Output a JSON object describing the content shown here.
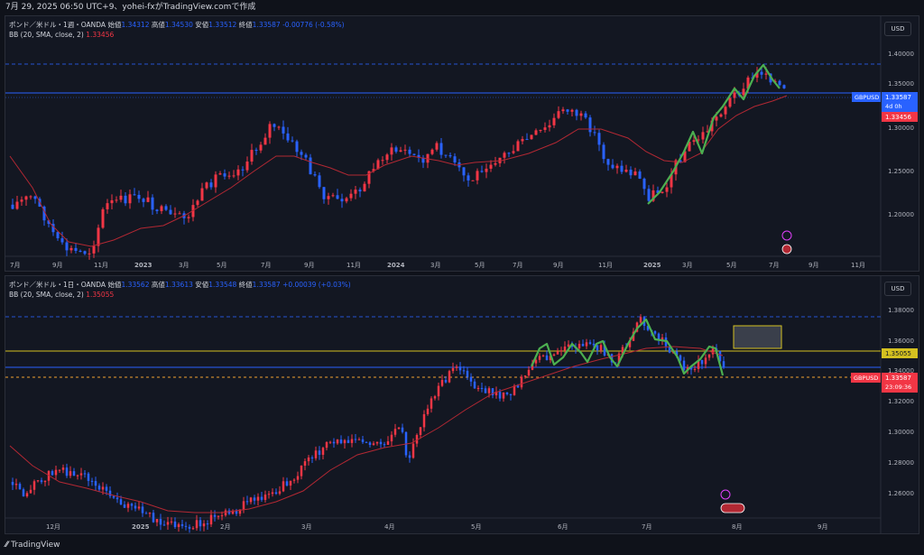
{
  "header": {
    "text": "7月 29, 2025 06:50 UTC+9、yohei-fxがTradingView.comで作成"
  },
  "top_chart": {
    "legend_title": "ポンド／米ドル・1週・OANDA",
    "open_label": "始値",
    "open": "1.34312",
    "high_label": "高値",
    "high": "1.34530",
    "low_label": "安値",
    "low": "1.33512",
    "close_label": "終値",
    "close": "1.33587",
    "change": "-0.00776 (-0.58%)",
    "bb_label": "BB (20, SMA, close, 2)",
    "bb_value": "1.33456",
    "currency": "USD",
    "price_ticks": [
      "1.40000",
      "1.35000",
      "1.30000",
      "1.25000",
      "1.20000"
    ],
    "time_ticks": [
      "7月",
      "9月",
      "11月",
      "2023",
      "3月",
      "5月",
      "7月",
      "9月",
      "11月",
      "2024",
      "3月",
      "5月",
      "7月",
      "9月",
      "11月",
      "2025",
      "3月",
      "5月",
      "7月",
      "9月",
      "11月"
    ],
    "symbol_tag": "GBPUSD",
    "price_tag": "1.33587",
    "countdown": "4d 0h",
    "bb_tag": "1.33456"
  },
  "bottom_chart": {
    "legend_title": "ポンド／米ドル・1日・OANDA",
    "open_label": "始値",
    "open": "1.33562",
    "high_label": "高値",
    "high": "1.33613",
    "low_label": "安値",
    "low": "1.33548",
    "close_label": "終値",
    "close": "1.33587",
    "change": "+0.00039 (+0.03%)",
    "bb_label": "BB (20, SMA, close, 2)",
    "bb_value": "1.35055",
    "currency": "USD",
    "price_ticks": [
      "1.38000",
      "1.36000",
      "1.34000",
      "1.32000",
      "1.30000",
      "1.28000",
      "1.26000"
    ],
    "time_ticks": [
      "12月",
      "2025",
      "2月",
      "3月",
      "4月",
      "5月",
      "6月",
      "7月",
      "8月",
      "9月"
    ],
    "symbol_tag": "GBPUSD",
    "price_tag": "1.33587",
    "countdown": "23:09:36",
    "line_tag": "1.35055"
  },
  "colors": {
    "up": "#f23645",
    "down": "#2962ff",
    "bb": "#b22833",
    "pattern": "#4caf50",
    "level": "#d4c020",
    "bg": "#131722"
  },
  "footer": {
    "brand": "TradingView"
  }
}
